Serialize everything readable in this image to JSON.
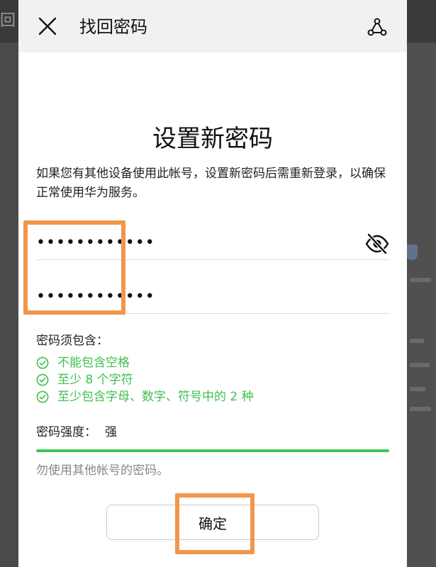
{
  "background": {
    "glyph": "回"
  },
  "header": {
    "title": "找回密码",
    "close_icon": "close-icon",
    "share_icon": "share-icon"
  },
  "page_title": "设置新密码",
  "description": "如果您有其他设备使用此帐号，设置新密码后需重新登录，以确保正常使用华为服务。",
  "password_field": {
    "value": "••••••••••••",
    "visibility_icon": "eye-off-icon"
  },
  "confirm_password_field": {
    "value": "••••••••••••"
  },
  "requirements": {
    "title": "密码须包含：",
    "items": [
      "不能包含空格",
      "至少 8 个字符",
      "至少包含字母、数字、符号中的 2 种"
    ],
    "check_icon": "check-circle-icon",
    "color": "#3fbf4f"
  },
  "strength": {
    "label": "密码强度：",
    "value": "强",
    "level": 1.0,
    "color": "#3ec94f"
  },
  "hint": "勿使用其他帐号的密码。",
  "confirm_button": {
    "label": "确定"
  },
  "highlight_color": "#f2964a"
}
